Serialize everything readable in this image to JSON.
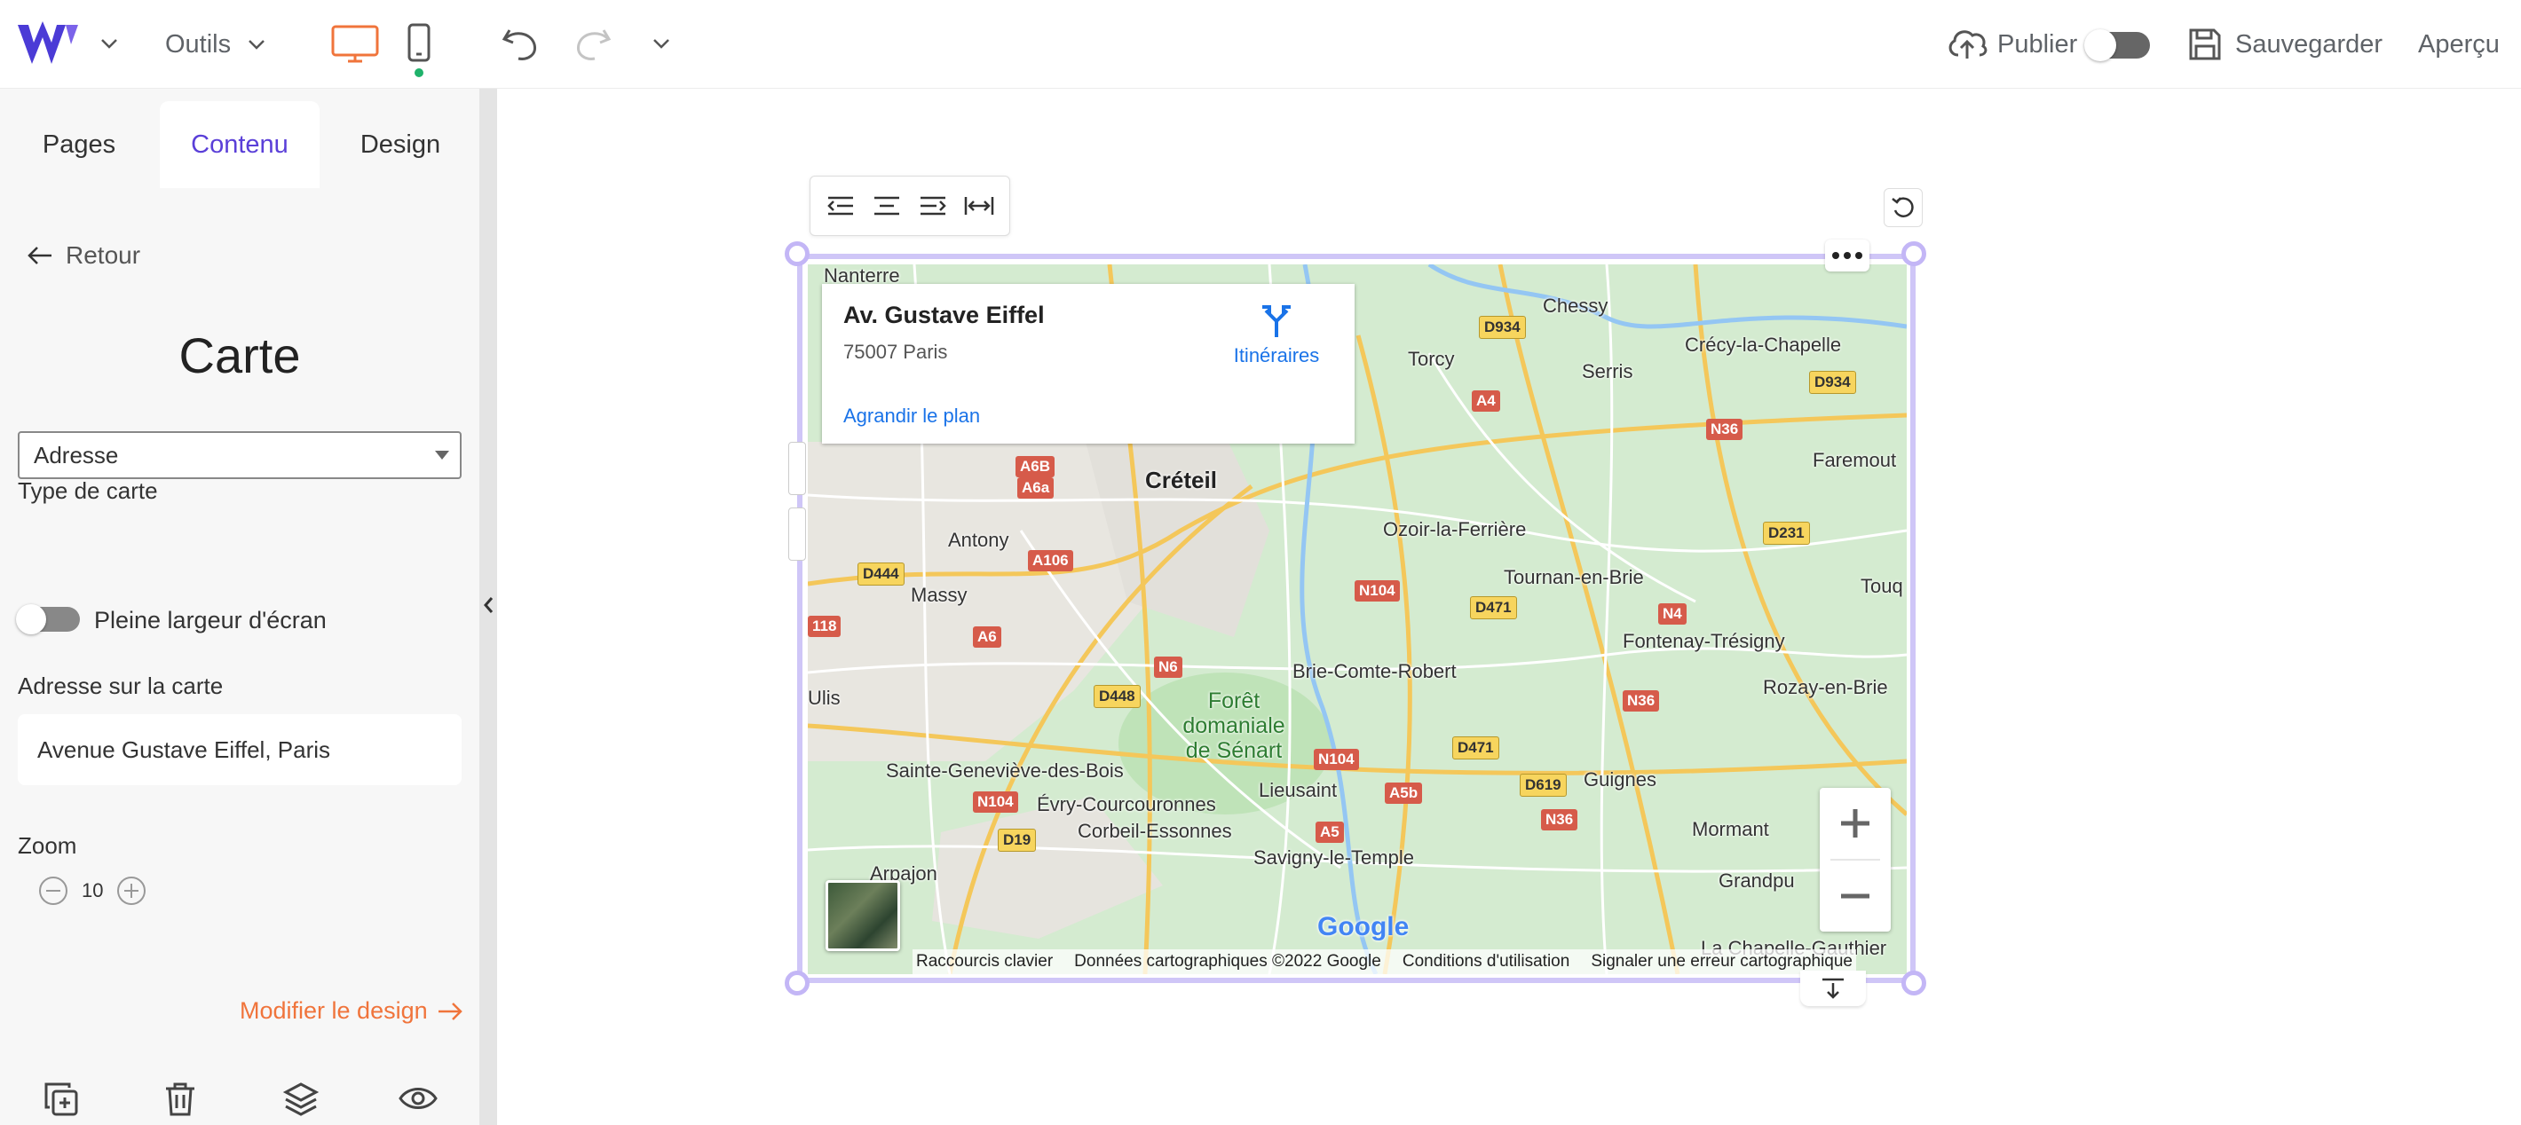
{
  "topbar": {
    "tools_label": "Outils",
    "publish_label": "Publier",
    "save_label": "Sauvegarder",
    "preview_label": "Aperçu"
  },
  "sidebar": {
    "tabs": [
      "Pages",
      "Contenu",
      "Design"
    ],
    "back_label": "Retour",
    "title": "Carte",
    "map_type_label": "Type de carte",
    "map_type_value": "Adresse",
    "fullwidth_label": "Pleine largeur d'écran",
    "address_label": "Adresse sur la carte",
    "address_value": "Avenue Gustave Eiffel, Paris",
    "zoom_label": "Zoom",
    "zoom_value": "10",
    "modify_design_label": "Modifier le design"
  },
  "map": {
    "info": {
      "title": "Av. Gustave Eiffel",
      "subtitle": "75007 Paris",
      "directions": "Itinéraires",
      "enlarge": "Agrandir le plan"
    },
    "labels": {
      "nanterre": "Nanterre",
      "chessy": "Chessy",
      "torcy": "Torcy",
      "serris": "Serris",
      "crecy": "Crécy-la-Chapelle",
      "faremoutiers": "Faremout",
      "creteil": "Créteil",
      "antony": "Antony",
      "ozoir": "Ozoir-la-Ferrière",
      "tournan": "Tournan-en-Brie",
      "massy": "Massy",
      "touq": "Touq",
      "fontenay": "Fontenay-Trésigny",
      "brie": "Brie-Comte-Robert",
      "ulis": "Ulis",
      "rozay": "Rozay-en-Brie",
      "foret": "Forêt domaniale de Sénart",
      "sgdb": "Sainte-Geneviève-des-Bois",
      "evry": "Évry-Courcouronnes",
      "lieusaint": "Lieusaint",
      "guignes": "Guignes",
      "corbeil": "Corbeil-Essonnes",
      "mormant": "Mormant",
      "arpajon": "Arpajon",
      "savigny": "Savigny-le-Temple",
      "grandpuits": "Grandpu",
      "chapelle": "La Chapelle-Gauthier",
      "google": "Google"
    },
    "roads": {
      "d934a": "D934",
      "d934b": "D934",
      "a4": "A4",
      "n36a": "N36",
      "a6b": "A6B",
      "a6a": "A6a",
      "d231": "D231",
      "d444": "D444",
      "a106": "A106",
      "n104a": "N104",
      "d471a": "D471",
      "n4": "N4",
      "r118": "118",
      "a6": "A6",
      "n6": "N6",
      "d448": "D448",
      "n36b": "N36",
      "d471b": "D471",
      "n104b": "N104",
      "a5b": "A5b",
      "d619": "D619",
      "n104c": "N104",
      "n36c": "N36",
      "d19": "D19",
      "a5": "A5"
    },
    "attribution": [
      "Raccourcis clavier",
      "Données cartographiques ©2022 Google",
      "Conditions d'utilisation",
      "Signaler une erreur cartographique"
    ]
  },
  "colors": {
    "brand": "#4b3bd6",
    "accent_orange": "#f0743b",
    "active_tab": "#5a3fd8",
    "selection": "#cfc6f7"
  }
}
